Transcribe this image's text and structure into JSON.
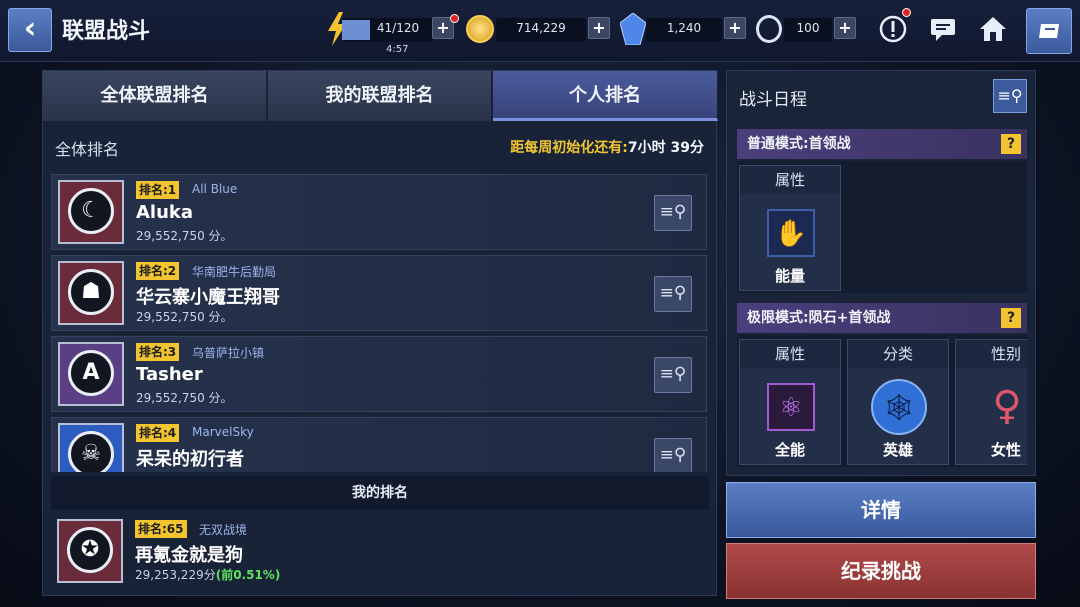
{
  "header": {
    "title": "联盟战斗",
    "back_icon": "‹",
    "energy_value": "41/120",
    "energy_timer": "4:57",
    "gold_value": "714,229",
    "crystal_value": "1,240",
    "token_value": "100",
    "plus_label": "+"
  },
  "tabs": [
    {
      "label": "全体联盟排名"
    },
    {
      "label": "我的联盟排名"
    },
    {
      "label": "个人排名"
    }
  ],
  "ranking": {
    "section_title": "全体排名",
    "reset_label": "距每周初始化还有:",
    "reset_value": "7小时 39分",
    "entries": [
      {
        "rank": "排名:1",
        "alliance": "All Blue",
        "name": "Aluka",
        "score": "29,552,750 分。",
        "avatar": "moon-knight-icon"
      },
      {
        "rank": "排名:2",
        "alliance": "华南肥牛后勤局",
        "name": "华云寨小魔王翔哥",
        "score": "29,552,750 分。",
        "avatar": "iron-man-icon"
      },
      {
        "rank": "排名:3",
        "alliance": "乌普萨拉小镇",
        "name": "Tasher",
        "score": "29,552,750 分。",
        "avatar": "avengers-icon"
      },
      {
        "rank": "排名:4",
        "alliance": "MarvelSky",
        "name": "呆呆的初行者",
        "score": "",
        "avatar": "ghost-rider-icon"
      }
    ],
    "my_rank_header": "我的排名",
    "my_entry": {
      "rank": "排名:65",
      "alliance": "无双战境",
      "name": "再氪金就是狗",
      "score": "29,253,229分",
      "percent": "(前0.51%)",
      "avatar": "falcon-icon"
    }
  },
  "schedule": {
    "title": "战斗日程",
    "mode_normal": "普通模式:首领战",
    "mode_extreme": "极限模式:陨石+首领战",
    "qmark": "?",
    "normal_cards": [
      {
        "label": "属性",
        "caption": "能量",
        "icon": "energy-icon"
      }
    ],
    "extreme_cards": [
      {
        "label": "属性",
        "caption": "全能",
        "icon": "universal-icon"
      },
      {
        "label": "分类",
        "caption": "英雄",
        "icon": "hero-icon"
      },
      {
        "label": "性别",
        "caption": "女性",
        "icon": "female-icon"
      }
    ]
  },
  "buttons": {
    "detail": "详情",
    "record": "纪录挑战"
  },
  "colors": {
    "accent_yellow": "#f2c530",
    "tab_active": "#4b5b9c",
    "detail_button": "#5b7ec4",
    "record_button": "#b04a4a",
    "percent_green": "#5de35b"
  }
}
